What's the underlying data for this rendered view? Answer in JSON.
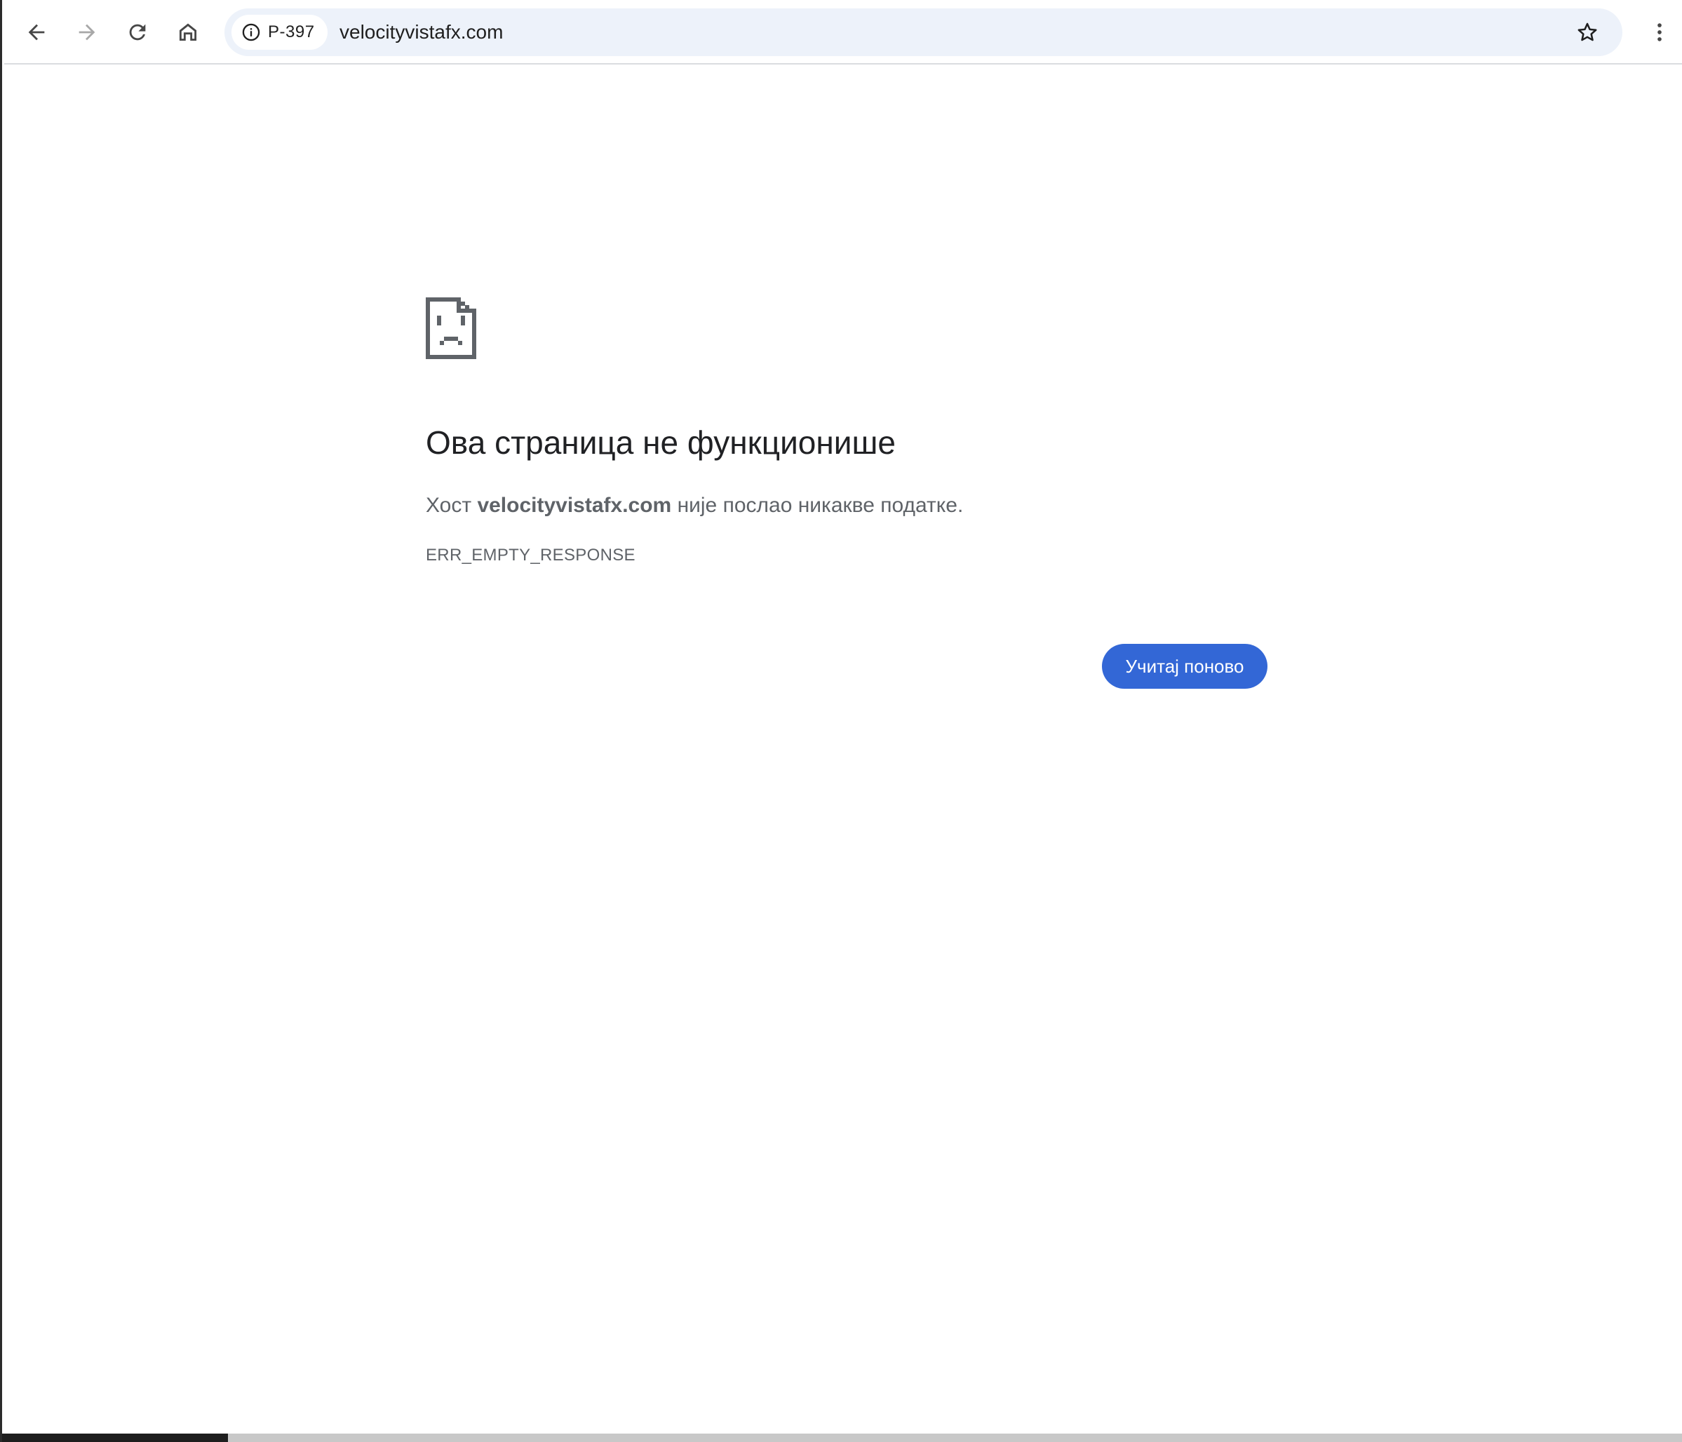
{
  "browser": {
    "security_chip": "P-397",
    "url": "velocityvistafx.com"
  },
  "error": {
    "title": "Ова страница не функционише",
    "summary_prefix": "Хост ",
    "summary_host": "velocityvistafx.com",
    "summary_suffix": " није послао никакве податке.",
    "code": "ERR_EMPTY_RESPONSE",
    "reload_label": "Учитај поново"
  },
  "icons": {
    "back": "arrow-left-icon",
    "forward": "arrow-right-icon",
    "reload": "reload-icon",
    "home": "home-icon",
    "info": "info-icon",
    "bookmark": "star-icon",
    "menu": "kebab-menu-icon",
    "error": "sad-document-icon"
  },
  "colors": {
    "accent": "#3367d6",
    "omnibox_bg": "#edf2fa",
    "text_primary": "#202124",
    "text_secondary": "#5f6368"
  }
}
